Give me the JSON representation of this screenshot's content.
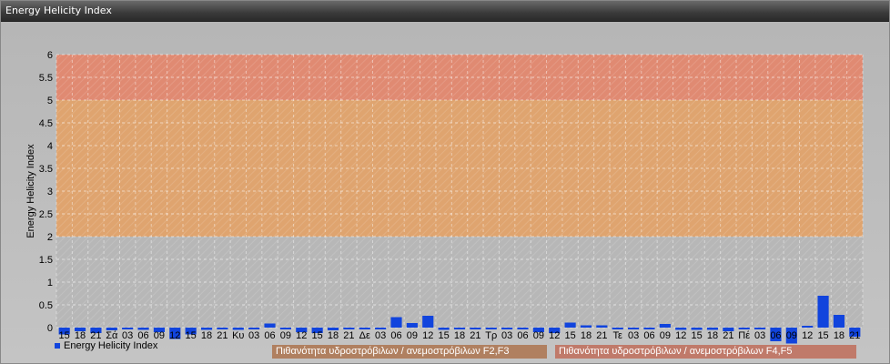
{
  "window": {
    "title": "Energy Helicity Index"
  },
  "colors": {
    "bar": "#1144dd",
    "zone_low": "#b7b7b7",
    "zone_mid": "#dfa46f",
    "zone_high": "#e08a72"
  },
  "legend": {
    "series_label": "Energy Helicity Index",
    "zone_f2f3": "Πιθανότητα υδροστρόβιλων / ανεμοστρόβιλων F2,F3",
    "zone_f4f5": "Πιθανότητα υδροστρόβιλων / ανεμοστρόβιλων F4,F5",
    "zone_f2f3_color": "#b08060",
    "zone_f4f5_color": "#c07a6a"
  },
  "chart_data": {
    "type": "bar",
    "title": "",
    "xlabel": "",
    "ylabel": "Energy Helicity Index",
    "ylim": [
      0,
      6
    ],
    "yticks": [
      "0",
      "0.5",
      "1",
      "1.5",
      "2",
      "2.5",
      "3",
      "3.5",
      "4",
      "4.5",
      "5",
      "5.5",
      "6"
    ],
    "zones": [
      {
        "from": 2,
        "to": 5
      },
      {
        "from": 5,
        "to": 6
      }
    ],
    "categories": [
      "15",
      "18",
      "21",
      "Σά",
      "03",
      "06",
      "09",
      "12",
      "15",
      "18",
      "21",
      "Κυ",
      "03",
      "06",
      "09",
      "12",
      "15",
      "18",
      "21",
      "Δε",
      "03",
      "06",
      "09",
      "12",
      "15",
      "18",
      "21",
      "Τρ",
      "03",
      "06",
      "09",
      "12",
      "15",
      "18",
      "21",
      "Τε",
      "03",
      "06",
      "09",
      "12",
      "15",
      "18",
      "21",
      "Πέ",
      "03",
      "06",
      "09",
      "12",
      "15",
      "18",
      "21"
    ],
    "series": [
      {
        "values": [
          -0.15,
          -0.08,
          -0.12,
          -0.06,
          -0.04,
          -0.05,
          -0.1,
          -0.25,
          -0.15,
          -0.05,
          -0.04,
          -0.05,
          -0.04,
          0.09,
          -0.04,
          -0.1,
          -0.12,
          -0.06,
          -0.04,
          -0.04,
          -0.04,
          0.23,
          0.1,
          0.26,
          -0.05,
          -0.04,
          -0.04,
          -0.04,
          -0.04,
          -0.04,
          -0.1,
          -0.12,
          0.11,
          0.05,
          0.05,
          -0.04,
          -0.04,
          -0.04,
          0.08,
          -0.05,
          -0.05,
          -0.05,
          -0.08,
          -0.04,
          -0.04,
          -0.3,
          -0.35,
          0.04,
          0.7,
          0.28,
          -0.2
        ]
      }
    ]
  }
}
